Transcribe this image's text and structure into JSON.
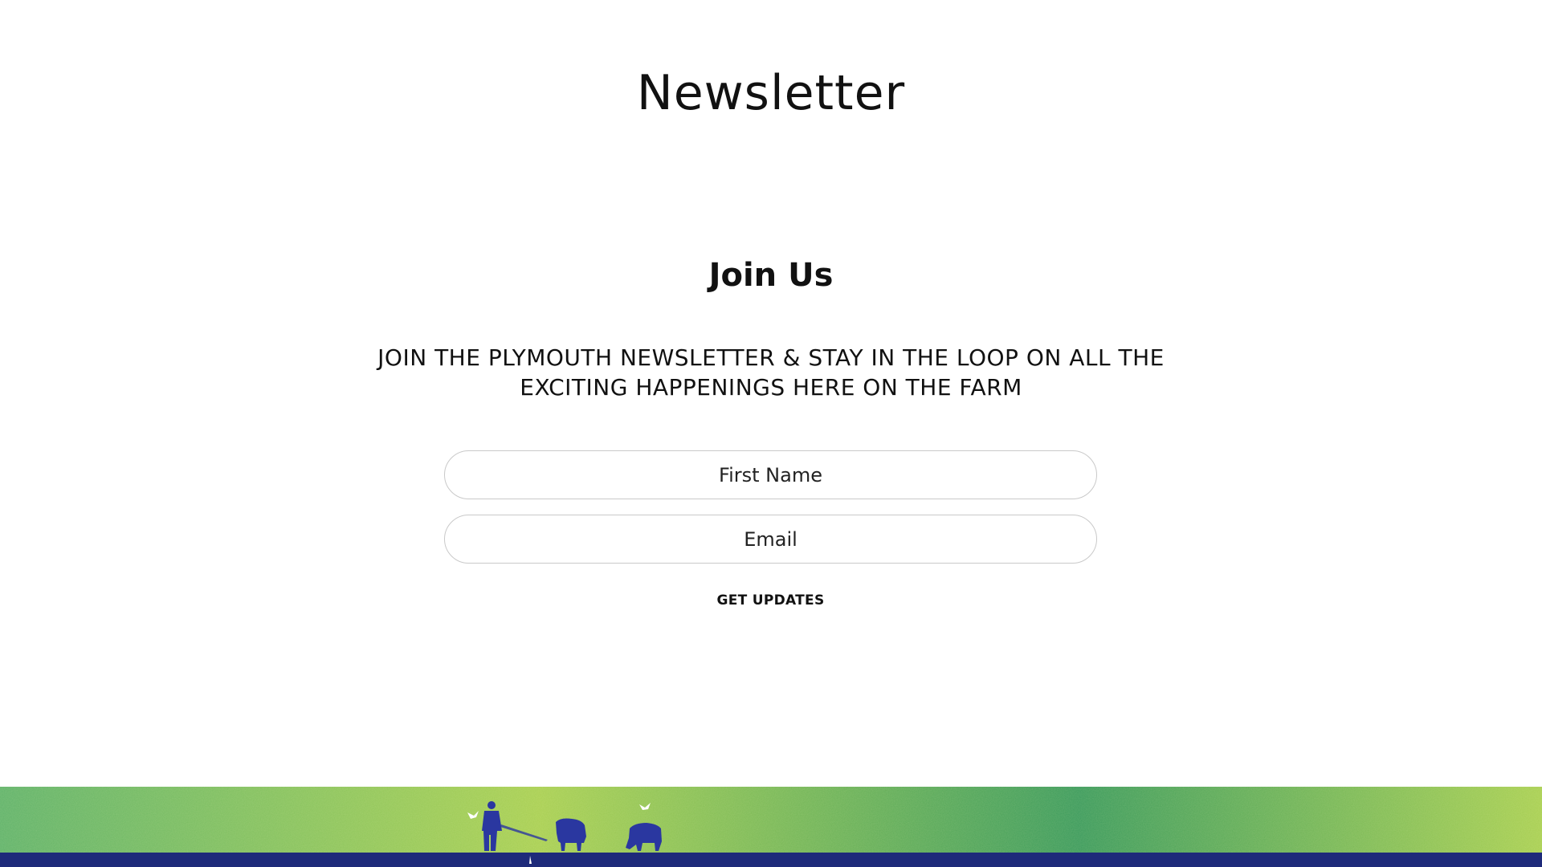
{
  "page": {
    "title": "Newsletter"
  },
  "signup": {
    "heading": "Join Us",
    "tagline": "JOIN THE PLYMOUTH NEWSLETTER & STAY IN THE LOOP ON ALL THE EXCITING HAPPENINGS HERE ON THE FARM",
    "first_name": {
      "placeholder": "First Name",
      "value": ""
    },
    "email": {
      "placeholder": "Email",
      "value": ""
    },
    "submit_label": "GET UPDATES"
  },
  "footer": {
    "illustration": "farm-field-illustration",
    "colors": {
      "grass_light": "#a8cf52",
      "grass_mid": "#5fb26a",
      "grass_dark": "#3a9a5c",
      "ground": "#1e2a7a",
      "figures": "#2a37a0"
    }
  }
}
